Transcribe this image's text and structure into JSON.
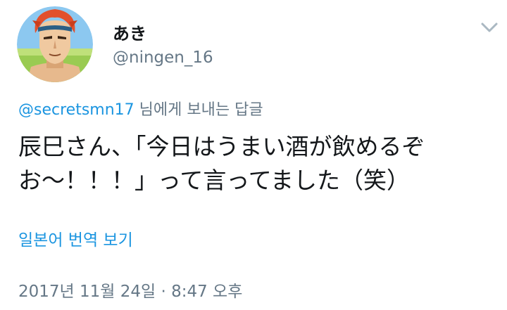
{
  "author": {
    "display_name": "あき",
    "handle": "@ningen_16",
    "avatar_icon": "anime-character-avatar-icon"
  },
  "menu_icon": "chevron-down-icon",
  "reply_to": {
    "mention": "@secretsmn17",
    "suffix": " 님에게 보내는 답글"
  },
  "tweet": {
    "line1": "辰巳さん、「今日はうまい酒が飲めるぞ",
    "line2": "お〜！！！」って言ってました（笑）"
  },
  "translate_label": "일본어 번역 보기",
  "timestamp": "2017년 11월 24일 · 8:47 오후",
  "colors": {
    "link": "#1b95e0",
    "text": "#14171a",
    "secondary": "#657786"
  }
}
